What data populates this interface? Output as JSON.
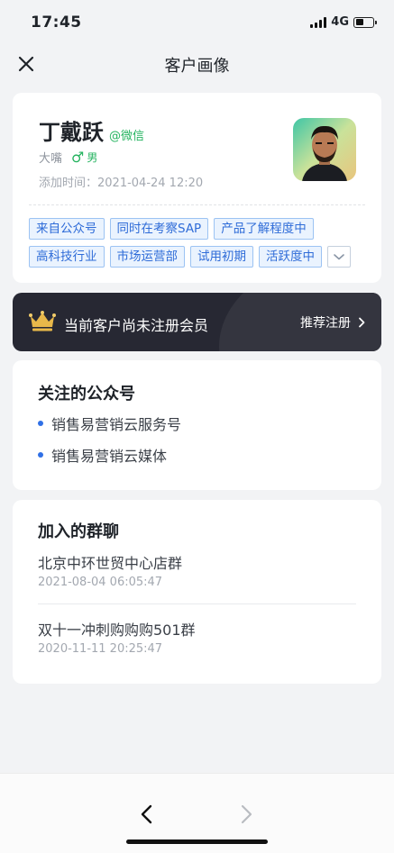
{
  "status_bar": {
    "time": "17:45",
    "network": "4G",
    "battery_level": 0.45
  },
  "nav": {
    "title": "客户画像",
    "close_icon": "close-icon"
  },
  "profile": {
    "name": "丁戴跃",
    "source_tag": "@微信",
    "nickname": "大嘴",
    "gender_symbol": "♂",
    "gender": "男",
    "add_time": "添加时间：2021-04-24 12:20",
    "tags": [
      "来自公众号",
      "同时在考察SAP",
      "产品了解程度中",
      "高科技行业",
      "市场运营部",
      "试用初期",
      "活跃度中"
    ],
    "more_icon": "chevron-down-icon"
  },
  "member_banner": {
    "text": "当前客户尚未注册会员",
    "link_label": "推荐注册",
    "icon": "crown-icon"
  },
  "subscriptions": {
    "title": "关注的公众号",
    "items": [
      "销售易营销云服务号",
      "销售易营销云媒体"
    ]
  },
  "groups": {
    "title": "加入的群聊",
    "items": [
      {
        "name": "北京中环世贸中心店群",
        "time": "2021-08-04 06:05:47"
      },
      {
        "name": "双十一冲刺购购购501群",
        "time": "2020-11-11 20:25:47"
      }
    ]
  },
  "bottom_nav": {
    "back_icon": "chevron-left-icon",
    "forward_icon": "chevron-right-icon"
  },
  "colors": {
    "accent_blue": "#2f6cd8",
    "wechat_green": "#24b35f",
    "banner_dark": "#272833",
    "crown_gold": "#e8b84a"
  }
}
